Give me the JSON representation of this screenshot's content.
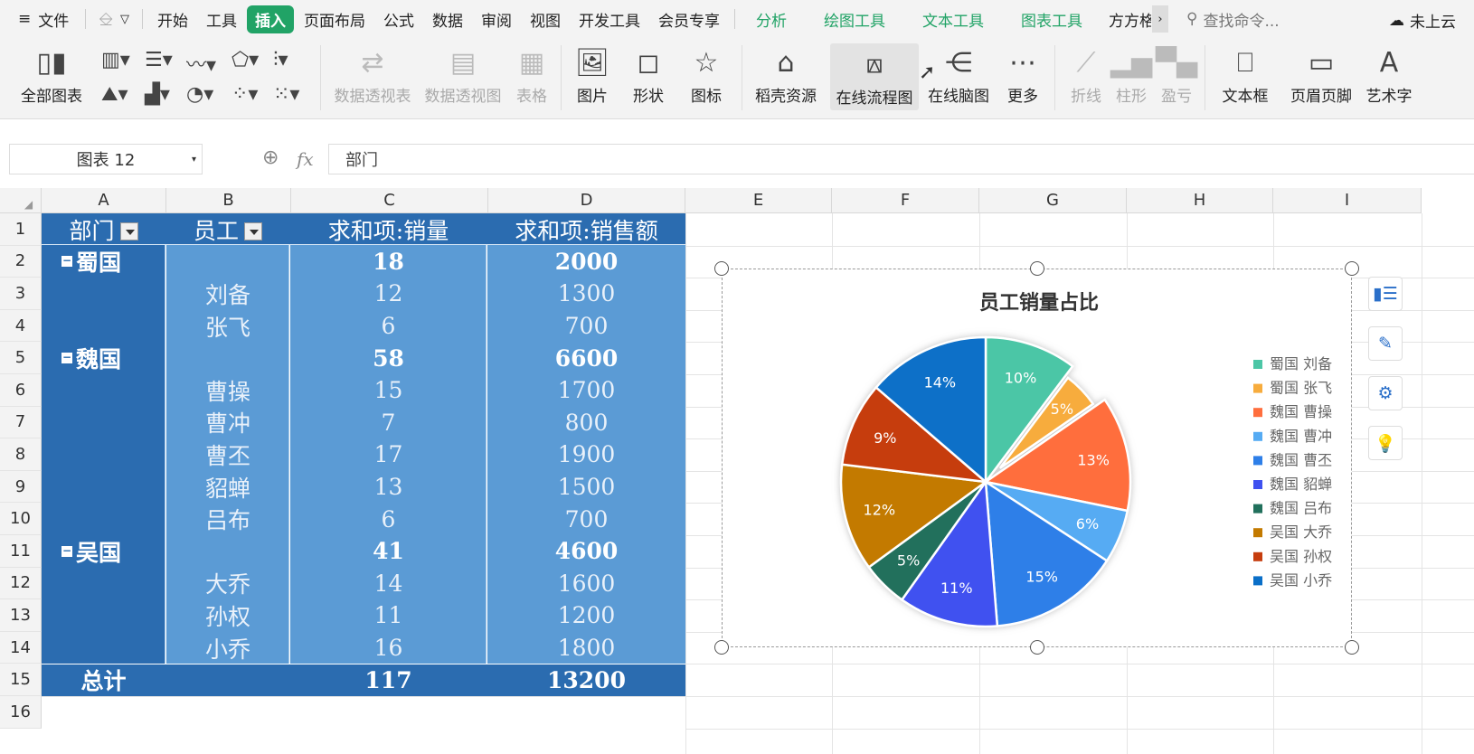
{
  "menubar": {
    "file_label": "文件",
    "tabs": [
      "开始",
      "工具",
      "插入",
      "页面布局",
      "公式",
      "数据",
      "审阅",
      "视图",
      "开发工具",
      "会员专享"
    ],
    "active_tab": "插入",
    "context_tabs": [
      "分析",
      "绘图工具",
      "文本工具",
      "图表工具"
    ],
    "truncated_tab": "方方格",
    "search_placeholder": "查找命令...",
    "cloud_label": "未上云"
  },
  "ribbon": {
    "all_charts": "全部图表",
    "pivot_table": "数据透视表",
    "pivot_chart": "数据透视图",
    "table": "表格",
    "picture": "图片",
    "shape": "形状",
    "icon": "图标",
    "docer": "稻壳资源",
    "flowchart": "在线流程图",
    "mindmap": "在线脑图",
    "more": "更多",
    "spark_line": "折线",
    "spark_column": "柱形",
    "spark_winloss": "盈亏",
    "textbox": "文本框",
    "header_footer": "页眉页脚",
    "wordart": "艺术字"
  },
  "formula_bar": {
    "name_box": "图表 12",
    "fx_label": "fx",
    "value": "部门"
  },
  "grid": {
    "columns": [
      "A",
      "B",
      "C",
      "D",
      "E",
      "F",
      "G",
      "H",
      "I"
    ],
    "rows": [
      "1",
      "2",
      "3",
      "4",
      "5",
      "6",
      "7",
      "8",
      "9",
      "10",
      "11",
      "12",
      "13",
      "14",
      "15",
      "16"
    ]
  },
  "pivot": {
    "headers": [
      "部门",
      "员工",
      "求和项:销量",
      "求和项:销售额"
    ],
    "rows": [
      {
        "dept": "蜀国",
        "emp": "",
        "qty": "18",
        "amt": "2000",
        "subtotal": true
      },
      {
        "dept": "",
        "emp": "刘备",
        "qty": "12",
        "amt": "1300",
        "subtotal": false
      },
      {
        "dept": "",
        "emp": "张飞",
        "qty": "6",
        "amt": "700",
        "subtotal": false
      },
      {
        "dept": "魏国",
        "emp": "",
        "qty": "58",
        "amt": "6600",
        "subtotal": true
      },
      {
        "dept": "",
        "emp": "曹操",
        "qty": "15",
        "amt": "1700",
        "subtotal": false
      },
      {
        "dept": "",
        "emp": "曹冲",
        "qty": "7",
        "amt": "800",
        "subtotal": false
      },
      {
        "dept": "",
        "emp": "曹丕",
        "qty": "17",
        "amt": "1900",
        "subtotal": false
      },
      {
        "dept": "",
        "emp": "貂蝉",
        "qty": "13",
        "amt": "1500",
        "subtotal": false
      },
      {
        "dept": "",
        "emp": "吕布",
        "qty": "6",
        "amt": "700",
        "subtotal": false
      },
      {
        "dept": "吴国",
        "emp": "",
        "qty": "41",
        "amt": "4600",
        "subtotal": true
      },
      {
        "dept": "",
        "emp": "大乔",
        "qty": "14",
        "amt": "1600",
        "subtotal": false
      },
      {
        "dept": "",
        "emp": "孙权",
        "qty": "11",
        "amt": "1200",
        "subtotal": false
      },
      {
        "dept": "",
        "emp": "小乔",
        "qty": "16",
        "amt": "1800",
        "subtotal": false
      }
    ],
    "total": {
      "label": "总计",
      "qty": "117",
      "amt": "13200"
    }
  },
  "colors": {
    "pivot_dark": "#2b6cb0",
    "pivot_light": "#5b9bd5",
    "accent_green": "#21a366"
  },
  "chart_data": {
    "type": "pie",
    "title": "员工销量占比",
    "legend_position": "right",
    "categories": [
      "蜀国 刘备",
      "蜀国 张飞",
      "魏国 曹操",
      "魏国 曹冲",
      "魏国 曹丕",
      "魏国 貂蝉",
      "魏国 吕布",
      "吴国 大乔",
      "吴国 孙权",
      "吴国 小乔"
    ],
    "values": [
      12,
      6,
      15,
      7,
      17,
      13,
      6,
      14,
      11,
      16
    ],
    "percent_labels": [
      "10%",
      "5%",
      "13%",
      "6%",
      "15%",
      "11%",
      "5%",
      "12%",
      "9%",
      "14%"
    ],
    "colors": [
      "#4cc6a6",
      "#f7ac3d",
      "#ff6e3d",
      "#56abf3",
      "#2e7fe8",
      "#3f51f0",
      "#21705c",
      "#c37a00",
      "#c63d0e",
      "#0a6fc8"
    ],
    "exploded": [
      "蜀国 张飞"
    ]
  }
}
